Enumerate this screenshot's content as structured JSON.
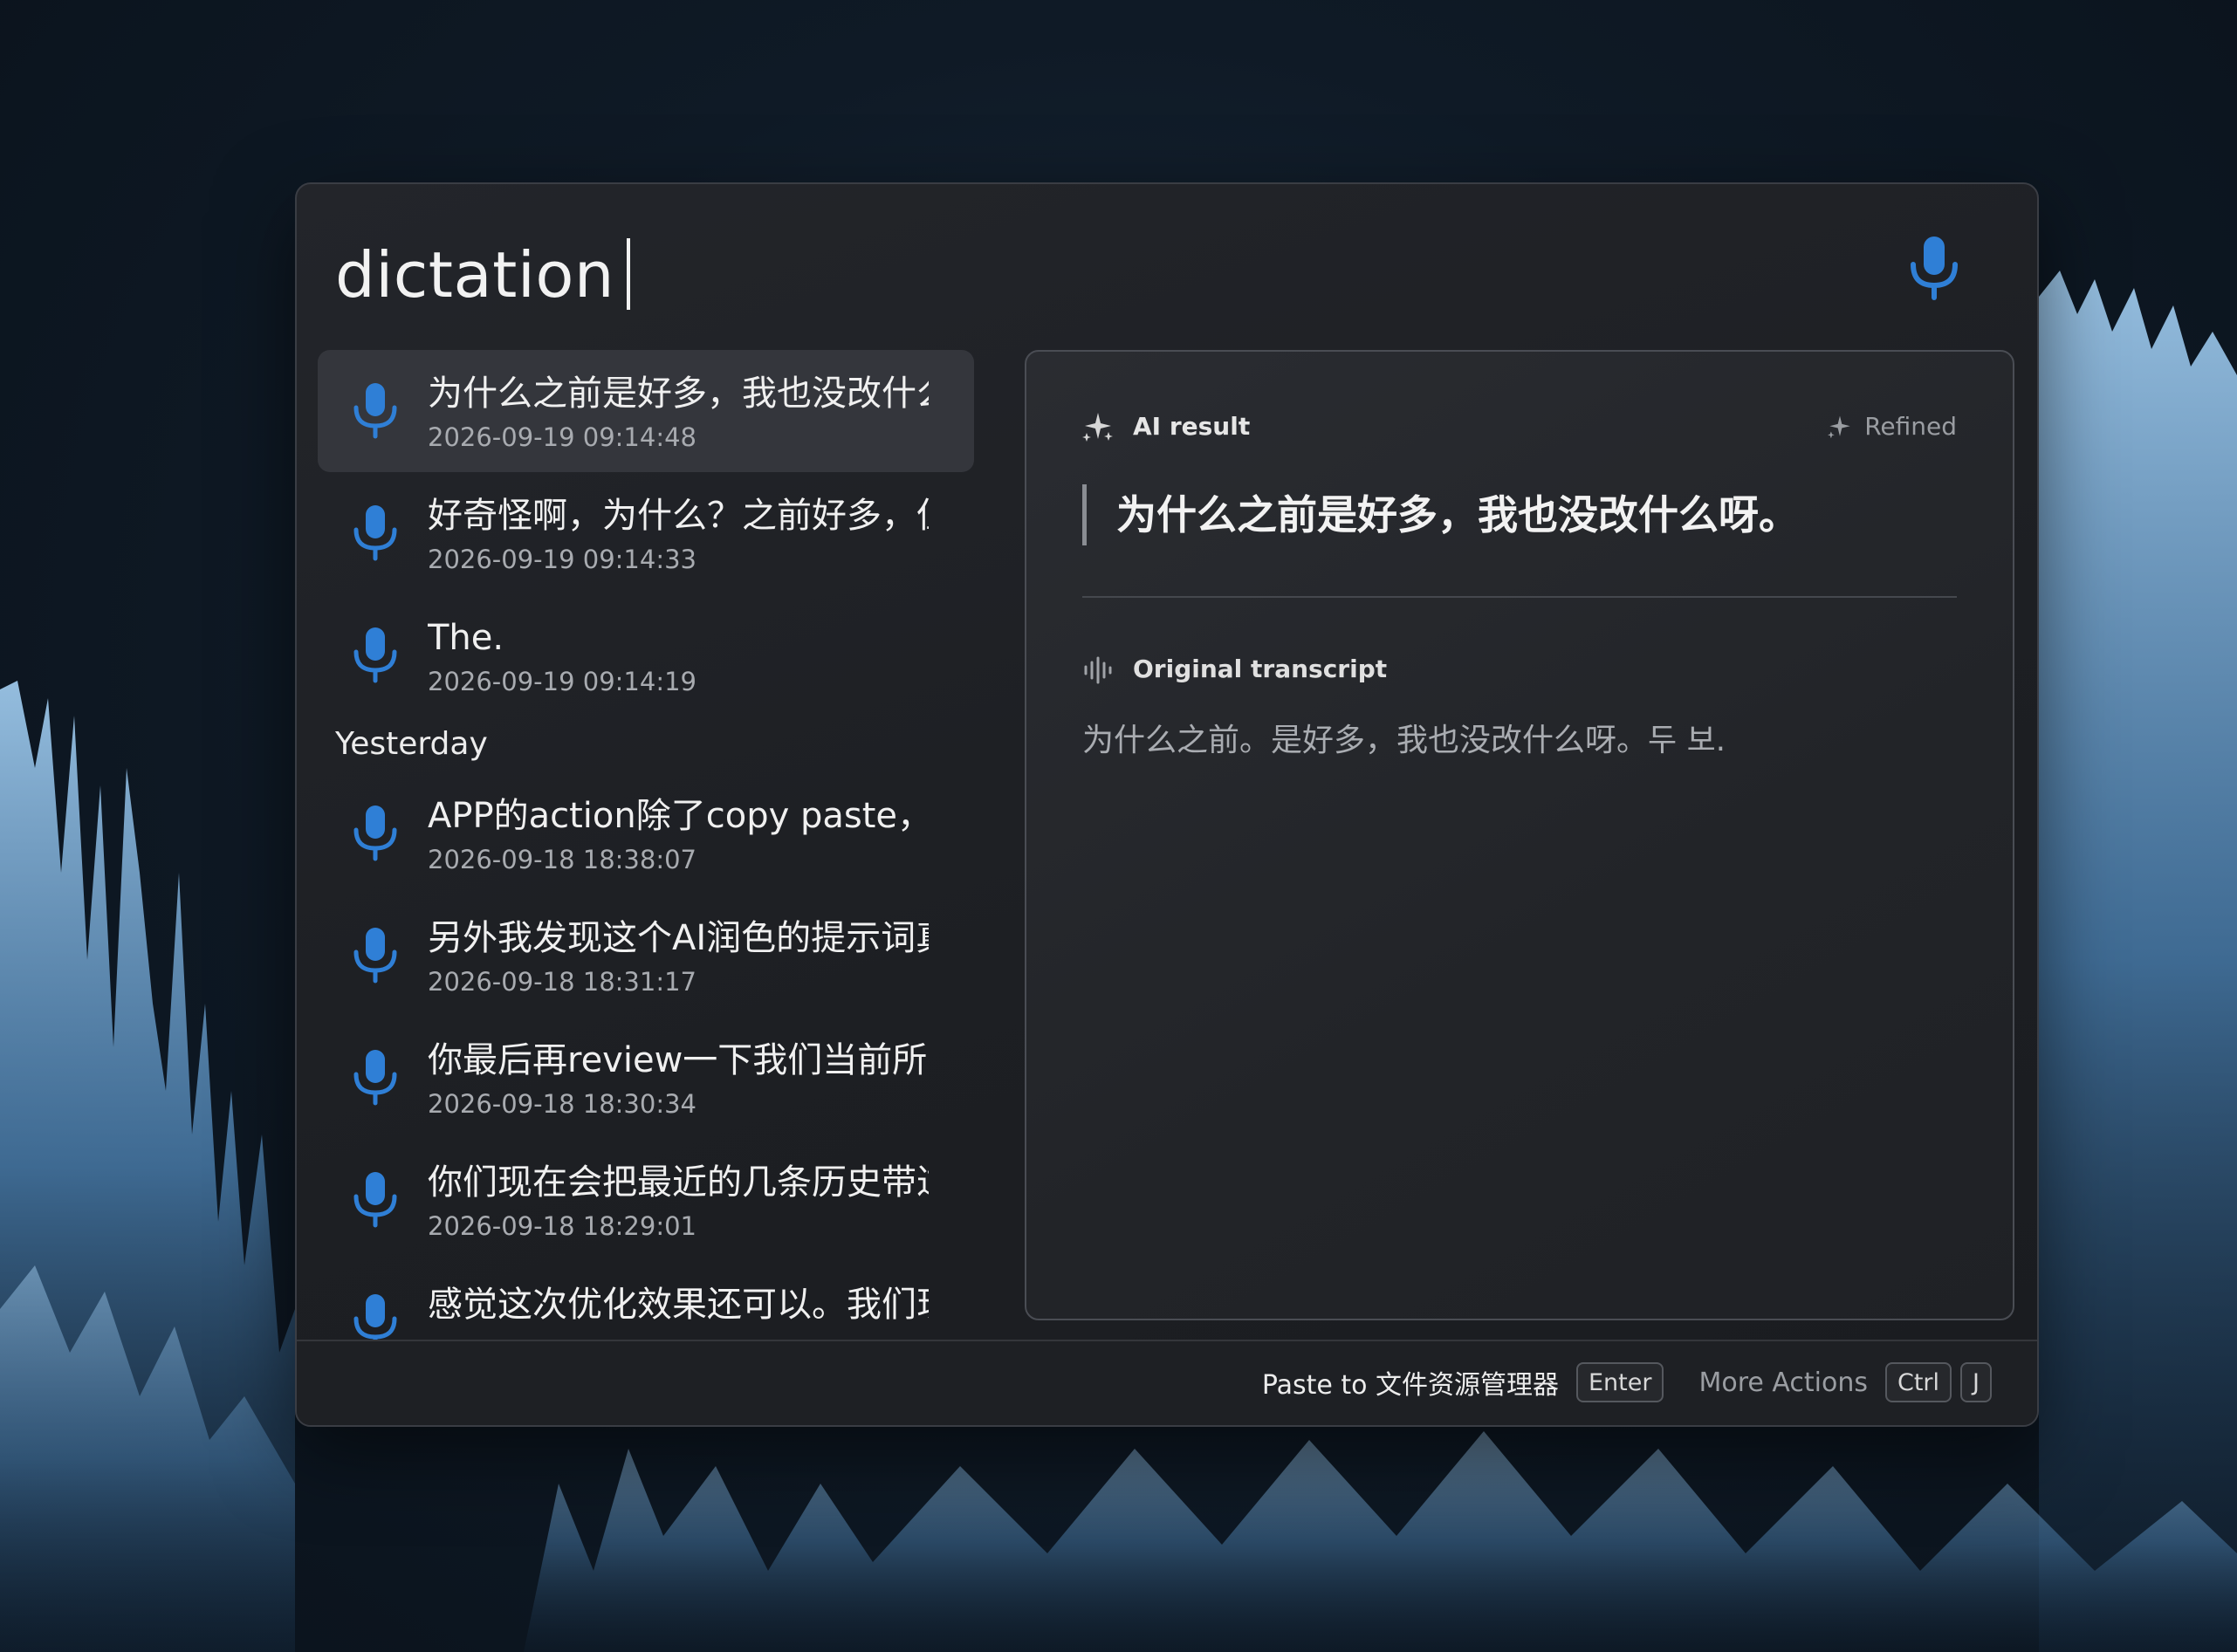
{
  "search": {
    "query": "dictation"
  },
  "colors": {
    "accent": "#2f7fd6",
    "panel_bg": "#1f2125",
    "selected_bg": "#34363c"
  },
  "history": {
    "recent": [
      {
        "title": "为什么之前是好多，我也没改什么呀。",
        "date": "2026-09-19 09:14:48",
        "icon": "microphone-icon",
        "selected": true
      },
      {
        "title": "好奇怪啊，为什么？之前好多，但是",
        "date": "2026-09-19 09:14:33",
        "icon": "microphone-icon"
      },
      {
        "title": "The.",
        "date": "2026-09-19 09:14:19",
        "icon": "microphone-icon"
      }
    ],
    "yesterday_label": "Yesterday",
    "yesterday": [
      {
        "title": "APP的action除了copy paste，还想",
        "date": "2026-09-18 18:38:07",
        "icon": "microphone-icon"
      },
      {
        "title": "另外我发现这个AI润色的提示词真的",
        "date": "2026-09-18 18:31:17",
        "icon": "microphone-icon"
      },
      {
        "title": "你最后再review一下我们当前所有的",
        "date": "2026-09-18 18:30:34",
        "icon": "microphone-icon"
      },
      {
        "title": "你们现在会把最近的几条历史带过去",
        "date": "2026-09-18 18:29:01",
        "icon": "microphone-icon"
      },
      {
        "title": "感觉这次优化效果还可以。我们现在",
        "date": "",
        "icon": "microphone-icon"
      }
    ]
  },
  "detail": {
    "ai_label": "AI result",
    "refined_label": "Refined",
    "ai_text": "为什么之前是好多，我也没改什么呀。",
    "original_label": "Original transcript",
    "original_text": "为什么之前。是好多，我也没改什么呀。두 보."
  },
  "footer": {
    "paste_label": "Paste to 文件资源管理器",
    "paste_key": "Enter",
    "more_label": "More Actions",
    "more_key_1": "Ctrl",
    "more_key_2": "J"
  }
}
